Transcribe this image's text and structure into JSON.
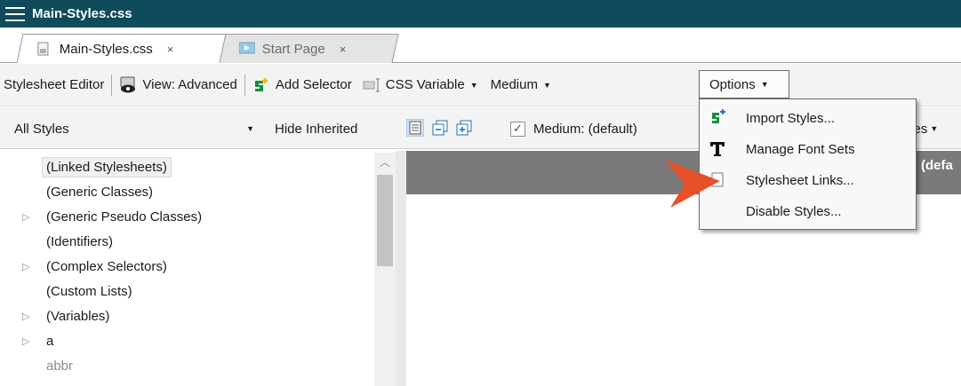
{
  "window": {
    "title": "Main-Styles.css"
  },
  "tabs": [
    {
      "label": "Main-Styles.css",
      "close": "×",
      "active": true
    },
    {
      "label": "Start Page",
      "close": "×",
      "active": false
    }
  ],
  "toolbar": {
    "editor_label": "Stylesheet Editor",
    "view_label": "View: Advanced",
    "add_selector_label": "Add Selector",
    "css_variable_label": "CSS Variable",
    "medium_label": "Medium",
    "options_label": "Options"
  },
  "filterbar": {
    "styles_value": "All Styles",
    "hide_inherited_label": "Hide Inherited",
    "medium_check_label": "Medium: (default)",
    "properties_partial": "rties"
  },
  "tree": {
    "items": [
      {
        "label": "(Linked Stylesheets)",
        "expandable": false
      },
      {
        "label": "(Generic Classes)",
        "expandable": false
      },
      {
        "label": "(Generic Pseudo Classes)",
        "expandable": true
      },
      {
        "label": "(Identifiers)",
        "expandable": false
      },
      {
        "label": "(Complex Selectors)",
        "expandable": true
      },
      {
        "label": "(Custom Lists)",
        "expandable": false
      },
      {
        "label": "(Variables)",
        "expandable": true
      },
      {
        "label": "a",
        "expandable": true
      },
      {
        "label": "abbr",
        "expandable": false
      }
    ]
  },
  "right_pane": {
    "header_partial": "(defa"
  },
  "options_menu": {
    "items": [
      {
        "label": "Import Styles...",
        "icon": "import-styles-icon"
      },
      {
        "label": "Manage Font Sets",
        "icon": "font-sets-icon"
      },
      {
        "label": "Stylesheet Links...",
        "icon": "stylesheet-links-icon"
      },
      {
        "label": "Disable Styles...",
        "icon": ""
      }
    ]
  },
  "colors": {
    "titlebar": "#0f4b5a",
    "pointer_arrow": "#e8502a",
    "grey_header": "#7a7a7a"
  }
}
